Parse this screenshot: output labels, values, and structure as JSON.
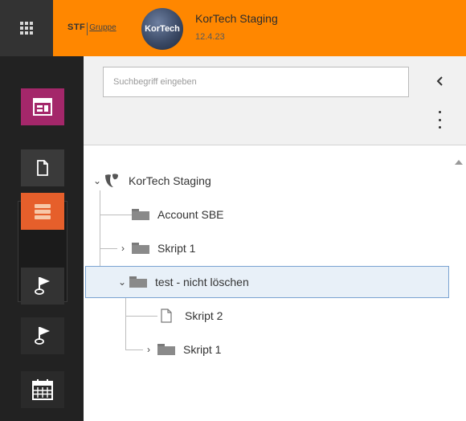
{
  "header": {
    "brand": {
      "stf": "STF",
      "gruppe": "Gruppe"
    },
    "site_logo_text": "KorTech",
    "site_name": "KorTech Staging",
    "version": "12.4.23",
    "accent_color": "#ff8700"
  },
  "modules": [
    {
      "id": "web-page",
      "icon": "page-module-icon",
      "color": "#a4276a"
    },
    {
      "id": "page",
      "icon": "document-icon",
      "color": "#333333"
    },
    {
      "id": "list",
      "icon": "database-icon",
      "color": "#e65f2b"
    },
    {
      "id": "flag-1",
      "icon": "flag-icon",
      "color": "#333333"
    },
    {
      "id": "flag-2",
      "icon": "flag-icon",
      "color": "#222222"
    },
    {
      "id": "calendar",
      "icon": "calendar-icon",
      "color": "#222222"
    }
  ],
  "tree_toolbar": {
    "search_placeholder": "Suchbegriff eingeben",
    "collapse_icon": "chevron-left-icon",
    "menu_icon": "ellipsis-vertical-icon"
  },
  "tree": {
    "root": {
      "label": "KorTech Staging",
      "expanded": true
    },
    "items": [
      {
        "label": "Account SBE",
        "type": "folder",
        "level": 1,
        "has_children": false
      },
      {
        "label": "Skript 1",
        "type": "folder",
        "level": 1,
        "has_children": true,
        "expanded": false
      },
      {
        "label": "test - nicht löschen",
        "type": "folder",
        "level": 1,
        "has_children": true,
        "expanded": true,
        "selected": true
      },
      {
        "label": "Skript 2",
        "type": "page",
        "level": 2,
        "has_children": false
      },
      {
        "label": "Skript 1",
        "type": "folder",
        "level": 2,
        "has_children": true,
        "expanded": false
      }
    ]
  }
}
